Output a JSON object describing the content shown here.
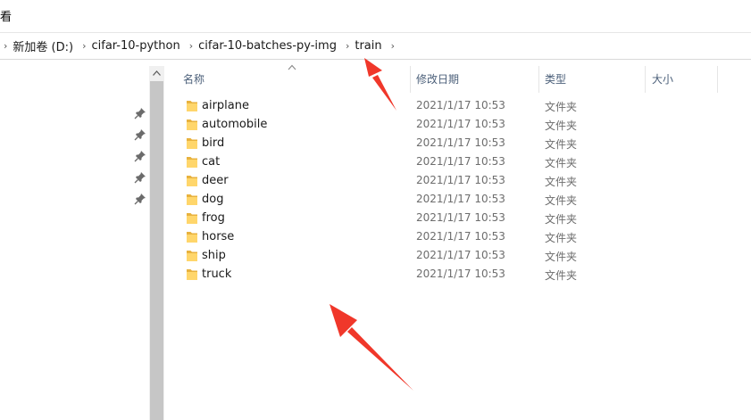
{
  "menu": {
    "view_label": "看"
  },
  "breadcrumbs": [
    "新加卷 (D:)",
    "cifar-10-python",
    "cifar-10-batches-py-img",
    "train"
  ],
  "columns": {
    "name": "名称",
    "date": "修改日期",
    "type": "类型",
    "size": "大小"
  },
  "files": [
    {
      "name": "airplane",
      "date": "2021/1/17 10:53",
      "type": "文件夹"
    },
    {
      "name": "automobile",
      "date": "2021/1/17 10:53",
      "type": "文件夹"
    },
    {
      "name": "bird",
      "date": "2021/1/17 10:53",
      "type": "文件夹"
    },
    {
      "name": "cat",
      "date": "2021/1/17 10:53",
      "type": "文件夹"
    },
    {
      "name": "deer",
      "date": "2021/1/17 10:53",
      "type": "文件夹"
    },
    {
      "name": "dog",
      "date": "2021/1/17 10:53",
      "type": "文件夹"
    },
    {
      "name": "frog",
      "date": "2021/1/17 10:53",
      "type": "文件夹"
    },
    {
      "name": "horse",
      "date": "2021/1/17 10:53",
      "type": "文件夹"
    },
    {
      "name": "ship",
      "date": "2021/1/17 10:53",
      "type": "文件夹"
    },
    {
      "name": "truck",
      "date": "2021/1/17 10:53",
      "type": "文件夹"
    }
  ],
  "colors": {
    "annotation_arrow": "#f0372a",
    "folder_fill": "#ffd66b",
    "header_text": "#4c607a"
  }
}
